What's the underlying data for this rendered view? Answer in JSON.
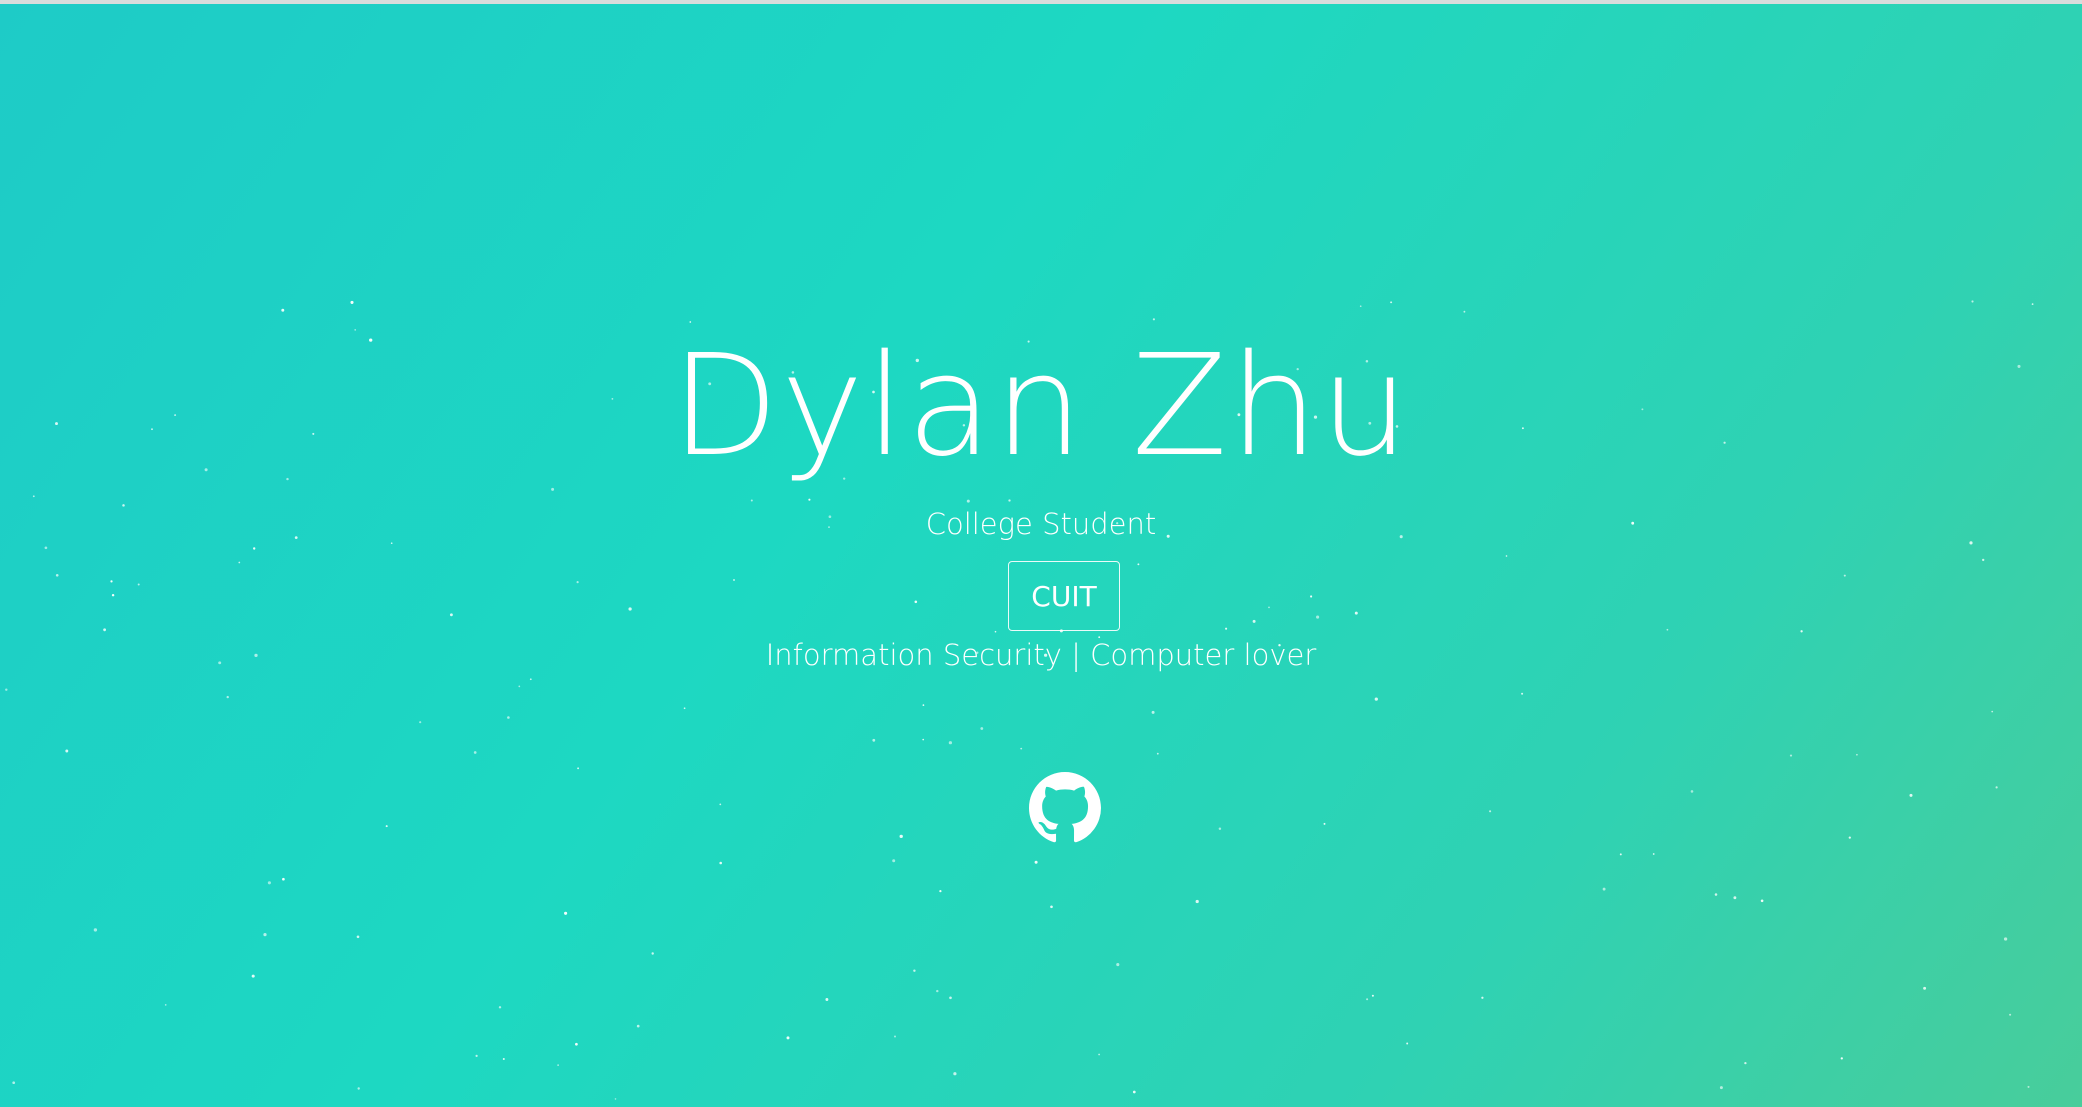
{
  "hero": {
    "name": "Dylan Zhu",
    "subtitle": "College Student",
    "tag_button_label": "CUIT",
    "interests": "Information Security | Computer lover"
  },
  "social": {
    "github_icon": "github-icon"
  },
  "colors": {
    "gradient_start": "#1ecbc7",
    "gradient_mid": "#1dd8c2",
    "gradient_end": "#48cd9b",
    "text": "#ffffff",
    "star": "#ffffff"
  }
}
